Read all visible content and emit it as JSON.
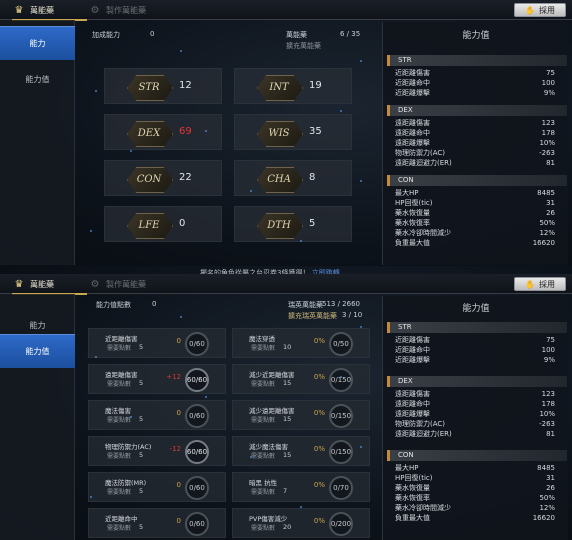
{
  "tabs": {
    "active": "萬能藥",
    "inactive": "製作萬能藥"
  },
  "apply_label": "採用",
  "panel1": {
    "sidebar": [
      "能力",
      "能力值"
    ],
    "added_ability_label": "加成能力",
    "added_ability_value": "0",
    "elixir_label": "萬能藥",
    "elixir_count": "6 / 35",
    "expand_label": "擴充萬能藥",
    "stats": [
      {
        "name": "STR",
        "value": "12",
        "red": false
      },
      {
        "name": "INT",
        "value": "19",
        "red": false
      },
      {
        "name": "DEX",
        "value": "69",
        "red": true
      },
      {
        "name": "WIS",
        "value": "35",
        "red": false
      },
      {
        "name": "CON",
        "value": "22",
        "red": false
      },
      {
        "name": "CHA",
        "value": "8",
        "red": false
      },
      {
        "name": "LFE",
        "value": "0",
        "red": false
      },
      {
        "name": "DTH",
        "value": "5",
        "red": false
      }
    ]
  },
  "panel2": {
    "sidebar": [
      "能力",
      "能力值"
    ],
    "banner": "擺名的角色從屬之台忍卷3條獲得！",
    "banner_link": "立即跳轉",
    "points_label": "能力值點數",
    "points_value": "0",
    "elixir_label": "瑞英萬能藥",
    "elixir_count": "513 / 2660",
    "expand_label": "擴充瑞英萬能藥",
    "expand_count": "3 / 10",
    "points_word": "需要點數",
    "cards_left": [
      {
        "name": "近距離傷害",
        "points": "5",
        "bonus": "0",
        "bonus_red": false,
        "progress": "0/60",
        "full": false
      },
      {
        "name": "遠距離傷害",
        "points": "5",
        "bonus": "+12",
        "bonus_red": true,
        "progress": "60/60",
        "full": true
      },
      {
        "name": "魔法傷害",
        "points": "5",
        "bonus": "0",
        "bonus_red": false,
        "progress": "0/60",
        "full": false
      },
      {
        "name": "物理防禦力(AC)",
        "points": "5",
        "bonus": "-12",
        "bonus_red": true,
        "progress": "60/60",
        "full": true
      },
      {
        "name": "魔法防禦(MR)",
        "points": "5",
        "bonus": "0",
        "bonus_red": false,
        "progress": "0/60",
        "full": false
      },
      {
        "name": "近距離命中",
        "points": "5",
        "bonus": "0",
        "bonus_red": false,
        "progress": "0/60",
        "full": false
      }
    ],
    "cards_right": [
      {
        "name": "魔法穿透",
        "points": "10",
        "bonus": "0%",
        "bonus_red": false,
        "progress": "0/50",
        "full": false
      },
      {
        "name": "減少近距離傷害",
        "points": "15",
        "bonus": "0%",
        "bonus_red": false,
        "progress": "0/150",
        "full": false
      },
      {
        "name": "減少遠距離傷害",
        "points": "15",
        "bonus": "0%",
        "bonus_red": false,
        "progress": "0/150",
        "full": false
      },
      {
        "name": "減少魔法傷害",
        "points": "15",
        "bonus": "0%",
        "bonus_red": false,
        "progress": "0/150",
        "full": false
      },
      {
        "name": "暗黑 抗性",
        "points": "7",
        "bonus": "0%",
        "bonus_red": false,
        "progress": "0/70",
        "full": false
      },
      {
        "name": "PVP傷害減少",
        "points": "20",
        "bonus": "0%",
        "bonus_red": false,
        "progress": "0/200",
        "full": false
      }
    ]
  },
  "ability_panel": {
    "title": "能力值",
    "sections": [
      {
        "head": "STR",
        "rows": [
          [
            "近距離傷害",
            "75"
          ],
          [
            "近距離命中",
            "100"
          ],
          [
            "近距離爆擊",
            "9%"
          ]
        ]
      },
      {
        "head": "DEX",
        "rows": [
          [
            "遠距離傷害",
            "123"
          ],
          [
            "遠距離命中",
            "178"
          ],
          [
            "遠距離爆擊",
            "10%"
          ],
          [
            "物理防禦力(AC)",
            "-263"
          ],
          [
            "遠距離迴避力(ER)",
            "81"
          ]
        ]
      },
      {
        "head": "CON",
        "rows": [
          [
            "最大HP",
            "8485"
          ],
          [
            "HP回復(tic)",
            "31"
          ],
          [
            "藥水恢復量",
            "26"
          ],
          [
            "藥水恢復率",
            "50%"
          ],
          [
            "藥水冷卻時間減少",
            "12%"
          ],
          [
            "負重最大值",
            "16620"
          ]
        ]
      }
    ]
  }
}
